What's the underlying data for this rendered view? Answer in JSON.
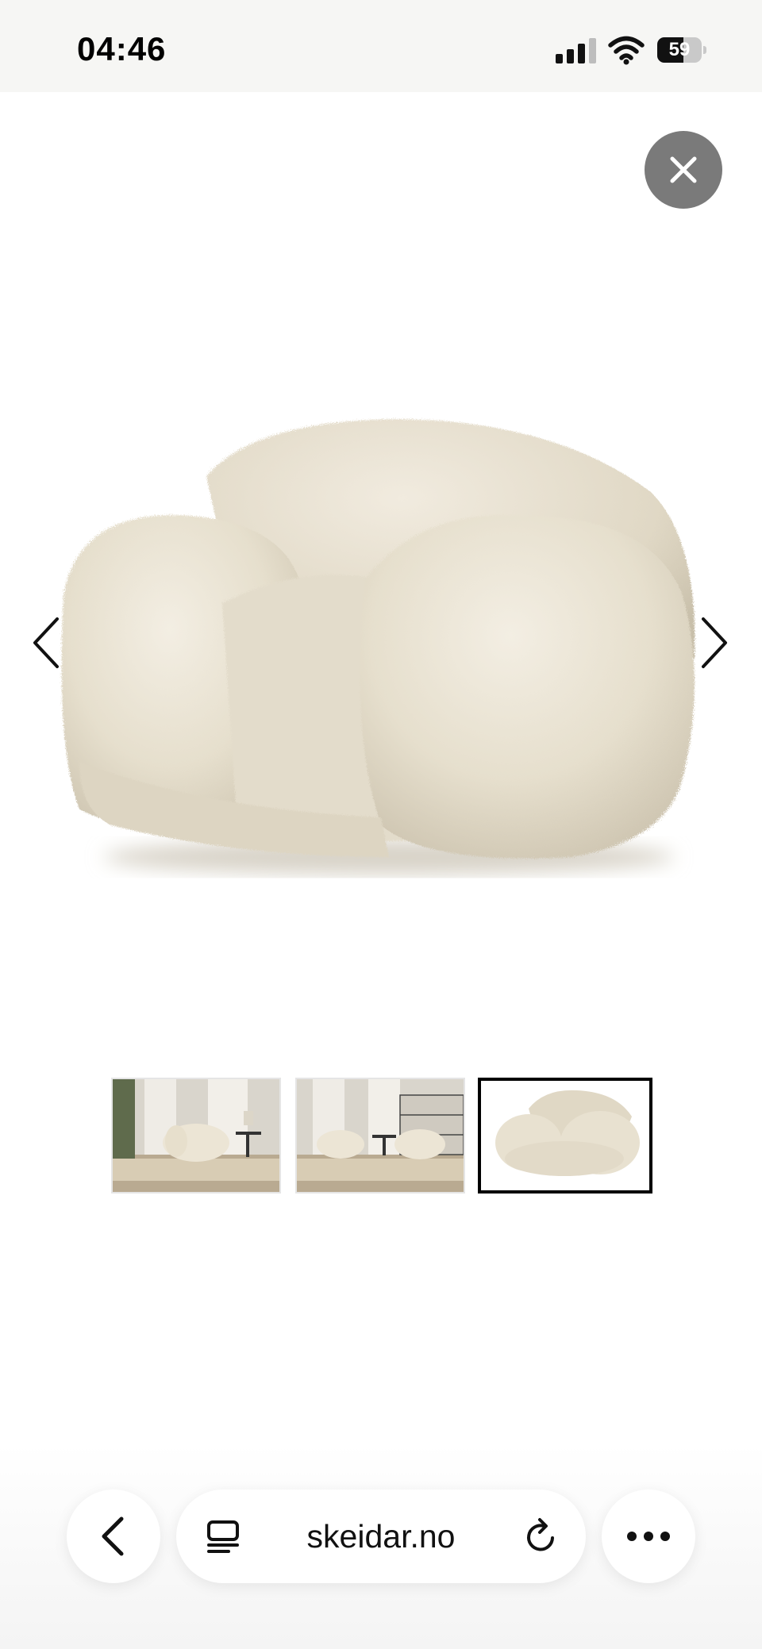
{
  "status_bar": {
    "time": "04:46",
    "battery_level": "59",
    "battery_fraction": 0.59,
    "signal_bars_active": 3,
    "signal_bars_total": 4
  },
  "viewer": {
    "close_icon": "close-icon",
    "prev_icon": "chevron-left-icon",
    "next_icon": "chevron-right-icon",
    "thumbnails": [
      {
        "id": "room-single-chair",
        "selected": false
      },
      {
        "id": "room-two-chairs",
        "selected": false
      },
      {
        "id": "chair-cutout",
        "selected": true
      }
    ]
  },
  "browser": {
    "url": "skeidar.no",
    "back_icon": "chevron-left-icon",
    "tabs_icon": "reader-icon",
    "reload_icon": "reload-icon",
    "more_icon": "ellipsis-icon"
  },
  "colors": {
    "close_button": "#7a7a7a",
    "thumbnail_selected_border": "#000000",
    "chair_fur": "#e9e2d2"
  }
}
